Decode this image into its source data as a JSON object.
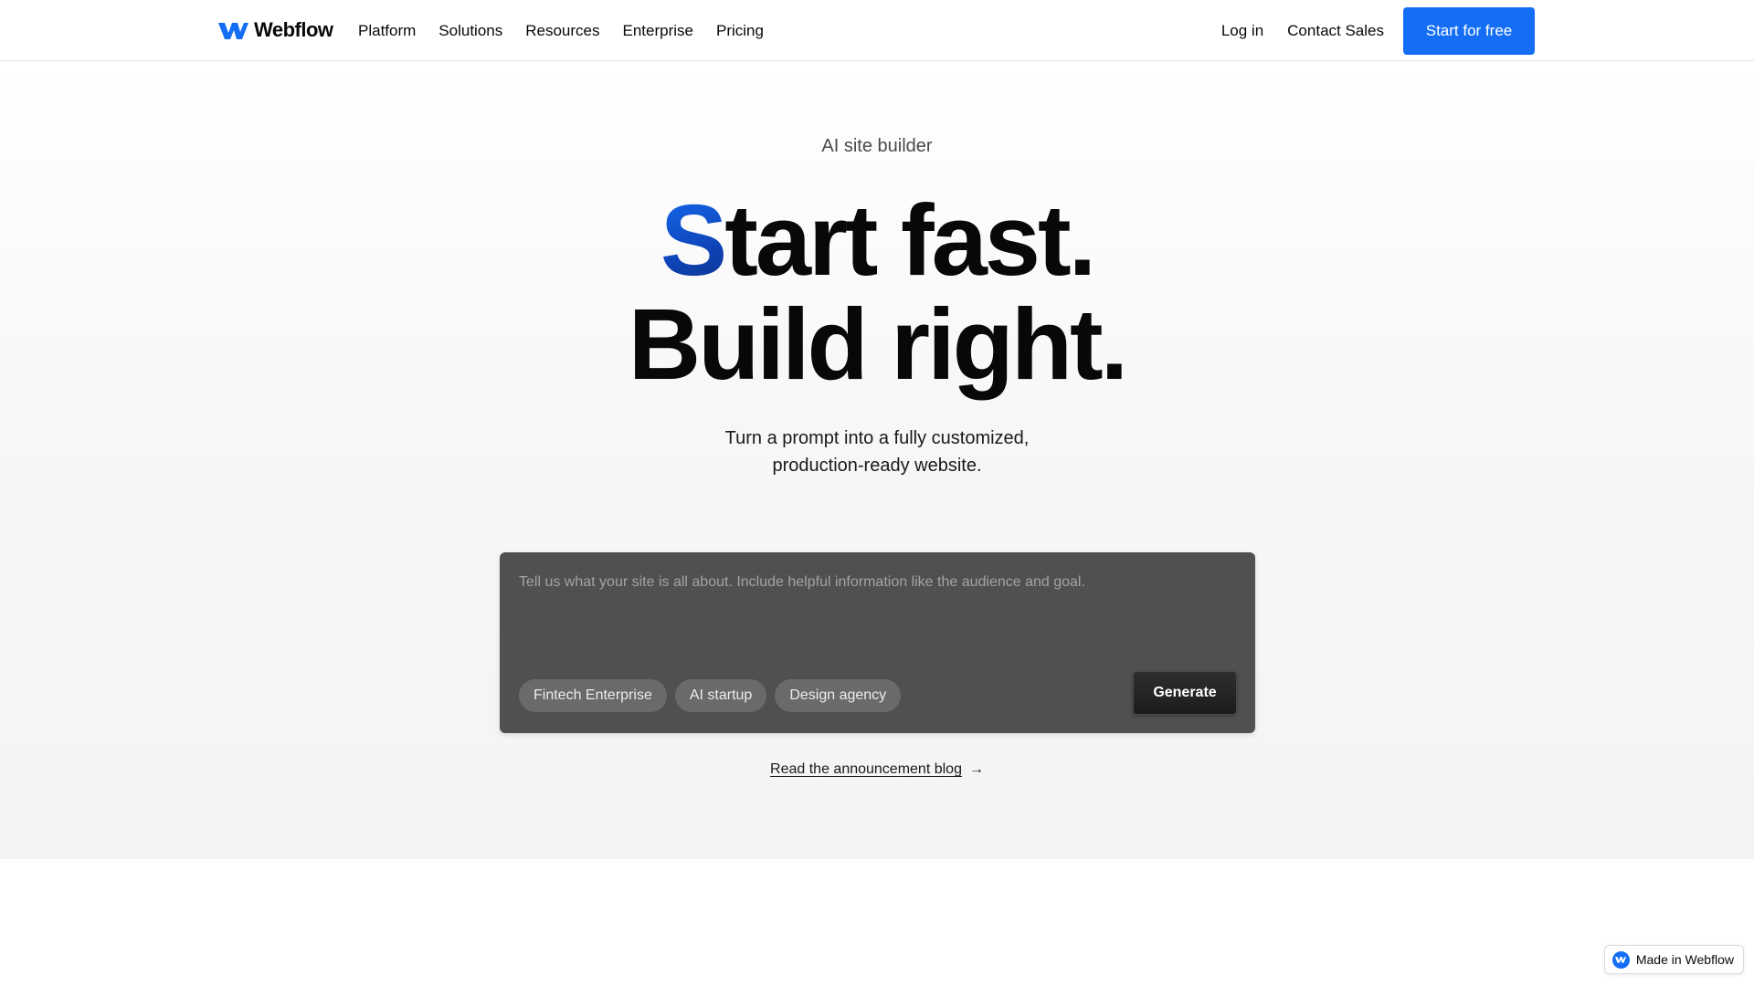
{
  "nav": {
    "logo_text": "Webflow",
    "links": [
      "Platform",
      "Solutions",
      "Resources",
      "Enterprise",
      "Pricing"
    ],
    "login": "Log in",
    "contact": "Contact Sales",
    "cta": "Start for free"
  },
  "hero": {
    "eyebrow": "AI site builder",
    "headline_accent": "S",
    "headline_line1_rest": "tart fast.",
    "headline_line2": "Build right.",
    "subhead_line1": "Turn a prompt into a fully customized,",
    "subhead_line2": "production-ready website."
  },
  "prompt": {
    "placeholder": "Tell us what your site is all about. Include helpful information like the audience and goal.",
    "chips": [
      "Fintech Enterprise",
      "AI startup",
      "Design agency"
    ],
    "generate": "Generate"
  },
  "announcement": {
    "link": "Read the announcement blog",
    "arrow": "→"
  },
  "badge": {
    "text": "Made in Webflow"
  },
  "colors": {
    "brand_blue": "#146ef5",
    "prompt_bg": "#505050",
    "text": "#080808"
  }
}
